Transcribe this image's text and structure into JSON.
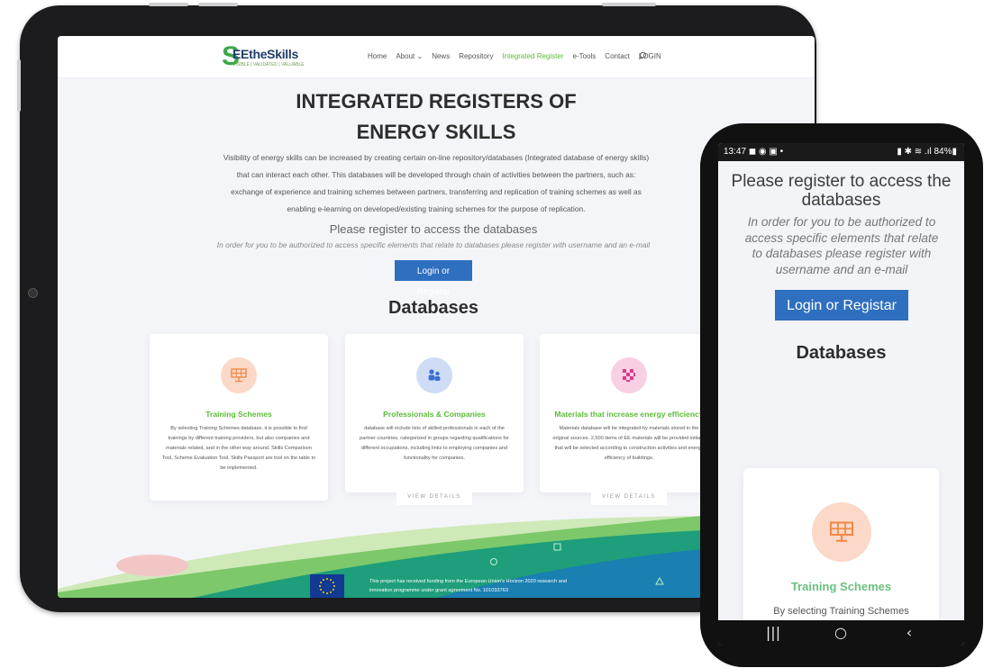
{
  "site": {
    "logo": {
      "text": "EEtheSkills",
      "tagline": "VISIBLE | VALIDATED | VALUABLE"
    },
    "nav": [
      {
        "label": "Home"
      },
      {
        "label": "About ⌄"
      },
      {
        "label": "News"
      },
      {
        "label": "Repository"
      },
      {
        "label": "Integrated Register",
        "active": true
      },
      {
        "label": "e-Tools"
      },
      {
        "label": "Contact"
      },
      {
        "label": "LOGIN"
      }
    ],
    "hero": {
      "title_line1": "INTEGRATED REGISTERS OF",
      "title_line2": "ENERGY SKILLS",
      "body": "Visibility of energy skills can be increased by creating certain on-line repository/databases (Integrated database of energy skills) that can interact each other. This databases will be developed through chain of activities between the partners, such as: exchange of experience and training schemes between partners, transferring and replication of training schemes as well as enabling e-learning on developed/existing training schemes for the purpose of replication."
    },
    "register": {
      "title": "Please register to access the databases",
      "subtitle": "In order for you to be authorized to access specific elements that relate to databases please register with username and an e-mail",
      "button": "Login or Registar"
    },
    "databases_heading": "Databases",
    "cards": [
      {
        "title": "Training Schemes",
        "icon": "solar-panel-icon",
        "icon_bg": "#fbd8c7",
        "body": "By selecting Training Schemes database, it is possible to find trainings by different training providers, but also companies and materials related, and in the other way around. Skills Comparison Tool, Scheme Evaluation Tool, Skills Passport are tool on the table to be implemented."
      },
      {
        "title": "Professionals & Companies",
        "icon": "people-icon",
        "icon_bg": "#cfdcf6",
        "body": "database will include lists of skilled professionals in each of the partner countries, categorized in groups regarding qualifications for different occupations, including links to employing companies and functionality for companies.",
        "button": "VIEW DETAILS"
      },
      {
        "title": "Materials that increase energy efficiency",
        "icon": "material-pattern-icon",
        "icon_bg": "#f8cfe3",
        "body": "Materials database will be integrated by materials stored in the original sources. 2,500 items of EE materials will be provided initially that will be selected according to construction activities and energy efficiency of buildings.",
        "button": "VIEW DETAILS"
      }
    ],
    "footer": {
      "funding": "This project has received funding from the European Union's Horizon 2020 research and innovation programme under grant agreement No. 101033763"
    }
  },
  "phone": {
    "status": {
      "time": "13:47",
      "left_icons": "◼ ◉ ▣  •",
      "right_icons": "▮ ✱ ≋ .ıl 84%▮"
    },
    "register_title": "Please register to access the databases",
    "register_subtitle": "In order for you to be authorized to access specific elements that relate to databases please register with username and an e-mail",
    "button": "Login or Registar",
    "databases_heading": "Databases",
    "card": {
      "title": "Training Schemes",
      "body": "By selecting Training Schemes"
    },
    "navbar": {
      "recent": "|||",
      "home": "○",
      "back": "‹"
    }
  }
}
